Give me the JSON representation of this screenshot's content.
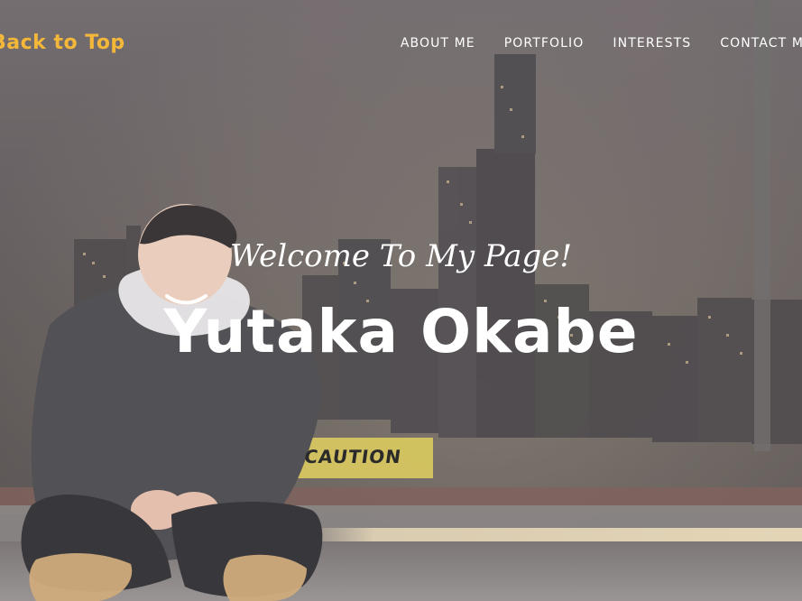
{
  "page": {
    "brand": "Back to Top",
    "nav": {
      "items": [
        {
          "label": "ABOUT ME"
        },
        {
          "label": "PORTFOLIO"
        },
        {
          "label": "INTERESTS"
        },
        {
          "label": "CONTACT ME"
        }
      ]
    },
    "hero": {
      "welcome": "Welcome To My Page!",
      "name": "Yutaka Okabe",
      "background_sign_text": "CAUTION"
    }
  },
  "colors": {
    "brand_accent": "#f3b83a",
    "text_primary": "#ffffff"
  }
}
